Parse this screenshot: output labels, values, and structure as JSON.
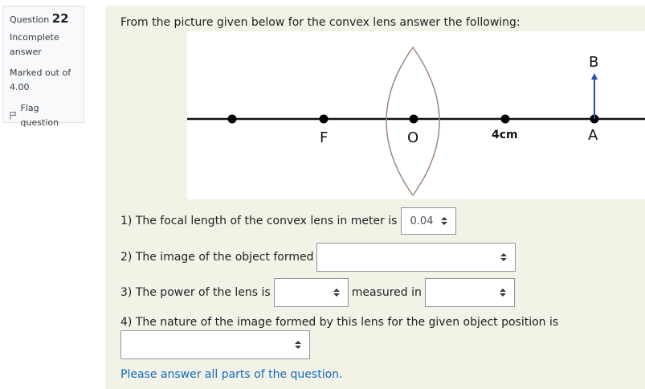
{
  "info": {
    "question_label": "Question",
    "question_number": "22",
    "state_line1": "Incomplete",
    "state_line2": "answer",
    "grade_line1": "Marked out of",
    "grade_line2": "4.00",
    "flag_label": "Flag question"
  },
  "question": {
    "text": "From the picture given below for the convex lens answer the following:"
  },
  "figure": {
    "labels": {
      "F": "F",
      "O": "O",
      "distance": "4cm",
      "A": "A",
      "B": "B"
    }
  },
  "q1": {
    "text": "1) The focal length of the convex lens in meter is",
    "value": "0.04"
  },
  "q2": {
    "text": "2) The image of the object formed",
    "value": ""
  },
  "q3": {
    "text": "3) The power of the lens is",
    "value": "",
    "middle": "measured in",
    "unit_value": ""
  },
  "q4": {
    "text": "4) The nature of the image formed by this lens for the given object position is",
    "value": ""
  },
  "hint": "Please answer all parts of the question.",
  "colors": {
    "panel": "#f3f2e6",
    "link": "#0f6cbf",
    "lens": "#a08878",
    "arrow": "#1f4fa8"
  },
  "icons": {
    "flag": "flag-icon",
    "select": "updown-arrows-icon"
  }
}
